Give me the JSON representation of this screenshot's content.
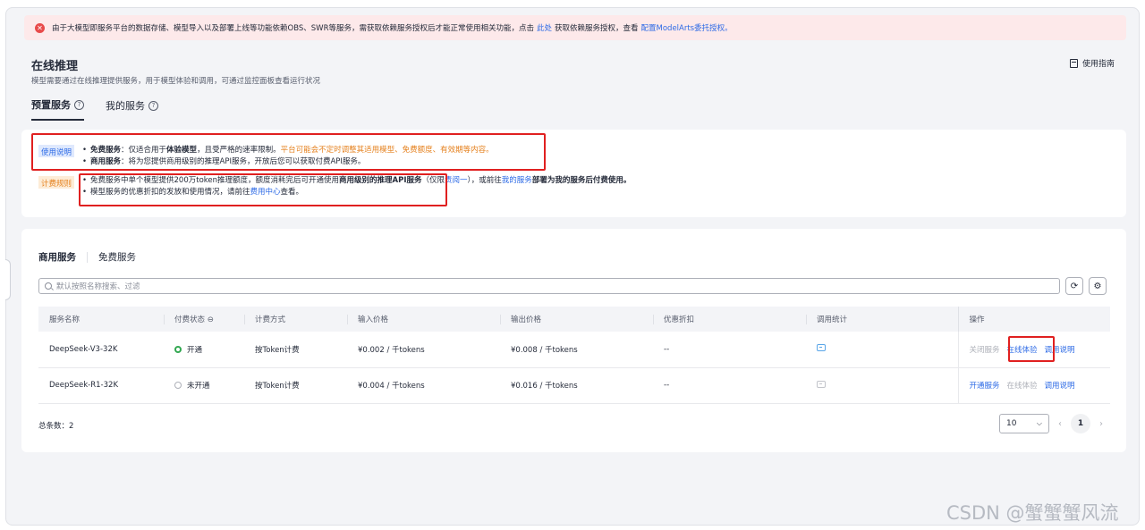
{
  "alert": {
    "text_1": "由于大模型即服务平台的数据存储、模型导入以及部署上线等功能依赖OBS、SWR等服务，需获取依赖服务授权后才能正常使用相关功能，点击",
    "link_here": "此处",
    "text_2": "获取依赖服务授权，查看",
    "link_config": "配置ModelArts委托授权。"
  },
  "header": {
    "title": "在线推理",
    "description": "模型需要通过在线推理提供服务，用于模型体验和调用，可通过监控面板查看运行状况",
    "guide_label": "使用指南"
  },
  "top_tabs": [
    {
      "label": "预置服务"
    },
    {
      "label": "我的服务"
    }
  ],
  "usage": {
    "tag": "使用说明",
    "free_title": "免费服务",
    "free_text_1": "：仅适合用于",
    "free_bold": "体验模型",
    "free_text_2": "，且受严格的速率限制。",
    "free_warning": "平台可能会不定时调整其适用模型、免费额度、有效期等内容。",
    "commercial_title": "商用服务",
    "commercial_text": "：将为您提供商用级别的推理API服务，开放后您可以获取付费API服务。"
  },
  "billing": {
    "tag": "计费规则",
    "line1_text": "免费服务中单个模型提供200万token推理额度，额度消耗完后可开通使用",
    "line1_bold": "商用级别的推理API服务",
    "line1_text_2": "（仅限",
    "line1_link": "责阅一",
    "line1_text_3": "），或前往",
    "line1_link_2": "我的服务",
    "line1_bold_2": "部署为我的服务后付费使用。",
    "line2_text": "模型服务的优惠折扣的发放和使用情况，请前往",
    "line2_link": "费用中心",
    "line2_text_2": "查看。"
  },
  "sub_tabs": [
    {
      "label": "商用服务"
    },
    {
      "label": "免费服务"
    }
  ],
  "search": {
    "placeholder": "默认按照名称搜索、过滤"
  },
  "table": {
    "headers": [
      "服务名称",
      "付费状态",
      "计费方式",
      "输入价格",
      "输出价格",
      "优惠折扣",
      "调用统计",
      "操作"
    ],
    "rows": [
      {
        "name": "DeepSeek-V3-32K",
        "status": "开通",
        "billing": "按Token计费",
        "input_price": "¥0.002 / 千tokens",
        "output_price": "¥0.008 / 千tokens",
        "discount": "--",
        "actions": [
          "关闭服务",
          "在线体验",
          "调用说明"
        ]
      },
      {
        "name": "DeepSeek-R1-32K",
        "status": "未开通",
        "billing": "按Token计费",
        "input_price": "¥0.004 / 千tokens",
        "output_price": "¥0.016 / 千tokens",
        "discount": "--",
        "actions": [
          "开通服务",
          "在线体验",
          "调用说明"
        ]
      }
    ]
  },
  "footer": {
    "total": "总条数：2",
    "page_size": "10",
    "current_page": "1"
  },
  "watermark": "CSDN @蟹蟹蟹风流",
  "colors": {
    "link": "#2e6be6",
    "warning": "#e5811e",
    "error": "#e84a4a",
    "success": "#33a852",
    "highlight_box": "#e02020"
  }
}
